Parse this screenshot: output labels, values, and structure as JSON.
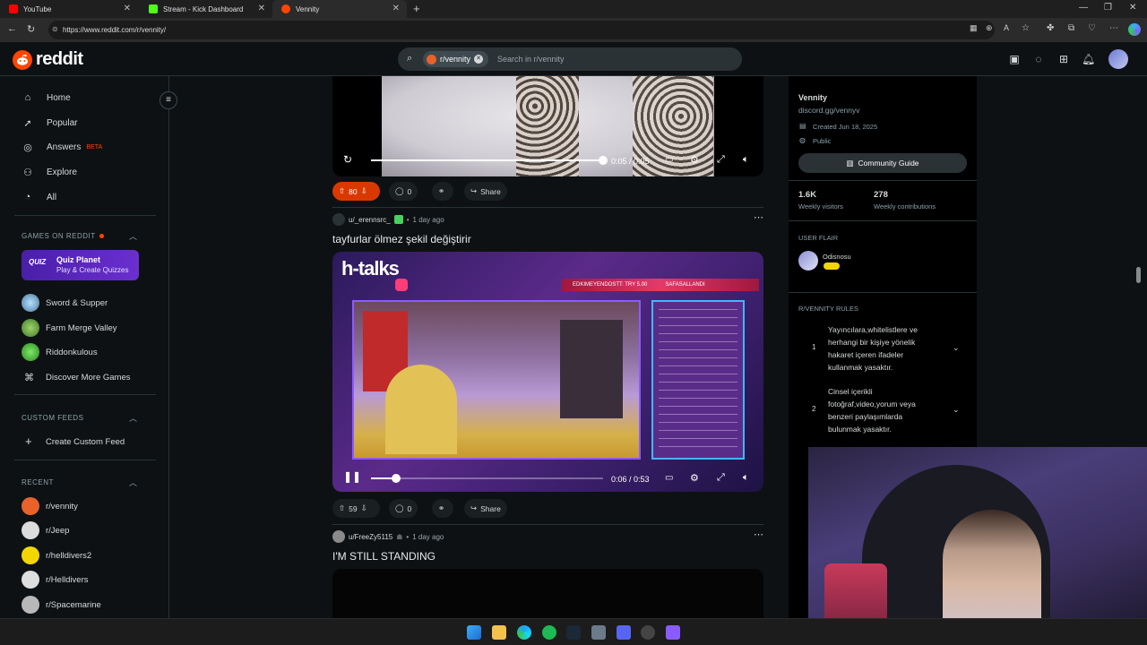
{
  "browser": {
    "tabs": [
      {
        "label": "YouTube",
        "color": "#ff0000"
      },
      {
        "label": "Stream - Kick Dashboard",
        "color": "#53fc18"
      },
      {
        "label": "Vennity",
        "color": "#ff4500"
      }
    ],
    "url": "https://www.reddit.com/r/vennity/"
  },
  "header": {
    "logo_text": "reddit",
    "search_chip": "r/vennity",
    "search_placeholder": "Search in r/vennity"
  },
  "sidebar": {
    "nav": [
      {
        "label": "Home",
        "icon": "home-icon"
      },
      {
        "label": "Popular",
        "icon": "popular-icon"
      },
      {
        "label": "Answers",
        "badge": "BETA",
        "icon": "answers-icon"
      },
      {
        "label": "Explore",
        "icon": "explore-icon"
      },
      {
        "label": "All",
        "icon": "all-icon"
      }
    ],
    "games_title": "GAMES ON REDDIT",
    "featured_game": {
      "name": "Quiz Planet",
      "subtitle": "Play & Create Quizzes",
      "logo": "QUIZ"
    },
    "games": [
      "Sword & Supper",
      "Farm Merge Valley",
      "Riddonkulous"
    ],
    "discover_label": "Discover More Games",
    "custom_feeds_title": "CUSTOM FEEDS",
    "create_feed_label": "Create Custom Feed",
    "recent_title": "RECENT",
    "recent": [
      "r/vennity",
      "r/Jeep",
      "r/helldivers2",
      "r/Helldivers",
      "r/Spacemarine"
    ]
  },
  "feed": {
    "post0": {
      "time": "0:05 / 0:05",
      "score": "80",
      "comments": "0",
      "share": "Share",
      "progress": 1.0
    },
    "post1": {
      "author": "u/_erennsrc_",
      "age": "1 day ago",
      "title": "tayfurlar ölmez şekil değiştirir",
      "overlay_brand": "h-talks",
      "overlay_banner": "EDKIMEYENDOSTT: TRY 5.00",
      "overlay_banner2": "SAFASALLANDI",
      "time": "0:06 / 0:53",
      "score": "59",
      "comments": "0",
      "share": "Share",
      "progress": 0.11
    },
    "post2": {
      "author": "u/FreeZy5115",
      "age": "1 day ago",
      "title": "I'M STILL STANDING"
    }
  },
  "rightbar": {
    "community_name": "Vennity",
    "discord": "discord.gg/vennyv",
    "created": "Created Jun 18, 2025",
    "visibility": "Public",
    "guide_button": "Community Guide",
    "visitors": "1.6K",
    "visitors_label": "Weekly visitors",
    "contributions": "278",
    "contributions_label": "Weekly contributions",
    "flair_title": "USER FLAIR",
    "flair_user": "Odisnosu",
    "rules_title": "R/VENNITY RULES",
    "rules": [
      {
        "num": "1",
        "text": "Yayıncılara,whitelistlere ve herhangi bir kişiye yönelik hakaret içeren ifadeler kullanmak yasaktır."
      },
      {
        "num": "2",
        "text": "Cinsel içerikli fotoğraf,video,yorum veya benzeri paylaşımlarda bulunmak yasaktır."
      }
    ]
  },
  "colors": {
    "accent": "#ff4500",
    "bg": "#0e1113",
    "upvote_active": "#d93900"
  }
}
